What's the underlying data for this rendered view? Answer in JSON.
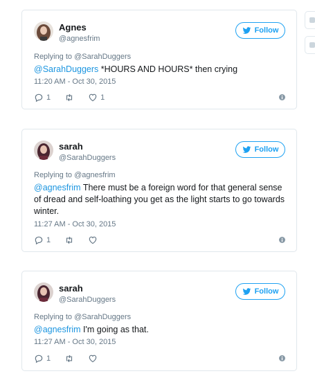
{
  "tweets": [
    {
      "name": "Agnes",
      "handle": "@agnesfrim",
      "follow_label": "Follow",
      "replying_to": "Replying to @SarahDuggers",
      "mention": "@SarahDuggers",
      "text": " *HOURS AND HOURS* then crying",
      "time": "11:20 AM - Oct 30, 2015",
      "reply_count": "1",
      "like_count": "1",
      "avatar_color": "#7a5a4a"
    },
    {
      "name": "sarah",
      "handle": "@SarahDuggers",
      "follow_label": "Follow",
      "replying_to": "Replying to @agnesfrim",
      "mention": "@agnesfrim",
      "text": " There must be a foreign word for that general sense of dread and self-loathing you get as the light starts to go towards winter.",
      "time": "11:27 AM - Oct 30, 2015",
      "reply_count": "1",
      "like_count": "",
      "avatar_color": "#5a2f3a"
    },
    {
      "name": "sarah",
      "handle": "@SarahDuggers",
      "follow_label": "Follow",
      "replying_to": "Replying to @SarahDuggers",
      "mention": "@agnesfrim",
      "text": " I'm going as that.",
      "time": "11:27 AM - Oct 30, 2015",
      "reply_count": "1",
      "like_count": "",
      "avatar_color": "#5a2f3a"
    }
  ],
  "colors": {
    "accent": "#1da1f2",
    "mention": "#1b95e0",
    "muted": "#657786",
    "border": "#e1e8ed"
  }
}
